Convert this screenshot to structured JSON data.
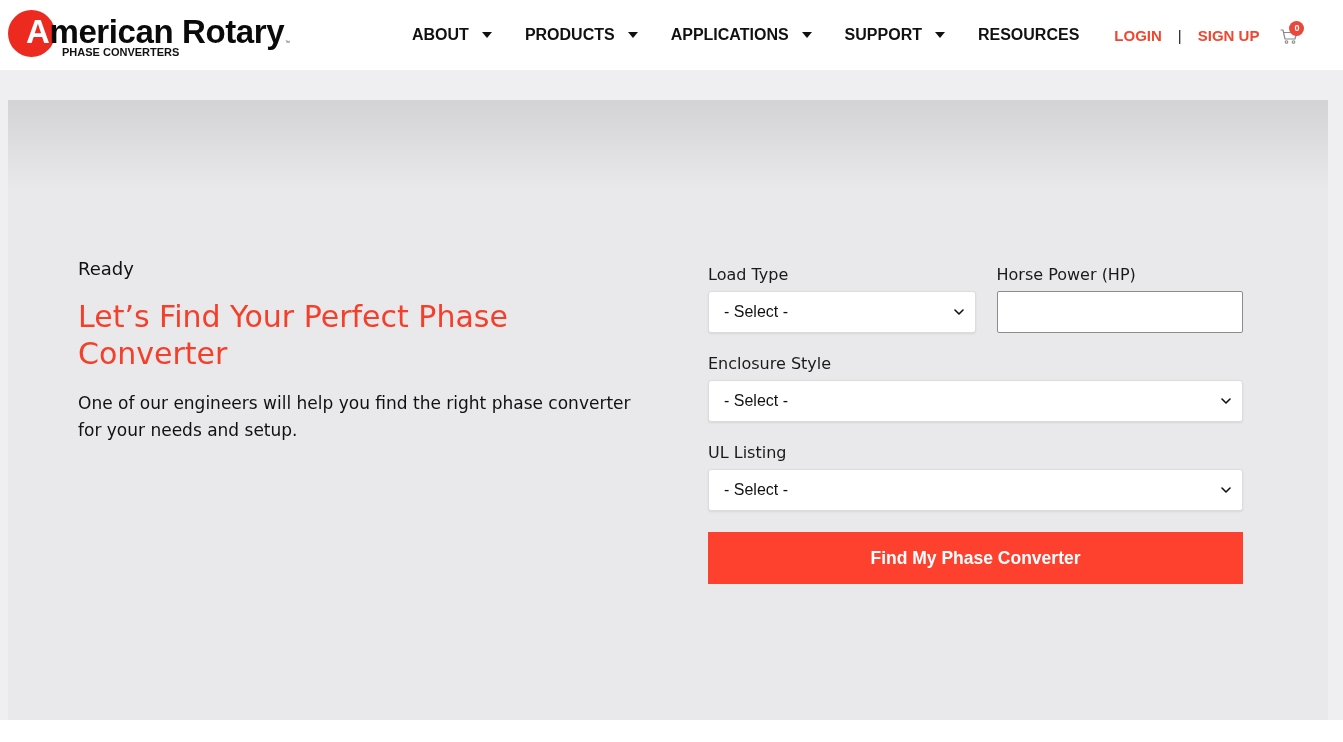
{
  "header": {
    "logo": {
      "name": "American Rotary",
      "trademark": "™",
      "tagline": "PHASE CONVERTERS"
    },
    "nav": [
      {
        "label": "ABOUT",
        "dropdown": true
      },
      {
        "label": "PRODUCTS",
        "dropdown": true
      },
      {
        "label": "APPLICATIONS",
        "dropdown": true
      },
      {
        "label": "SUPPORT",
        "dropdown": true
      },
      {
        "label": "RESOURCES",
        "dropdown": false
      }
    ],
    "account_links": [
      "LOGIN",
      "SIGN UP"
    ],
    "separator": "|",
    "cart": {
      "count": "0"
    }
  },
  "finder": {
    "eyebrow": "Ready",
    "title": "Let’s Find Your Perfect Phase Converter",
    "description": "One of our engineers will help you find the right phase converter for your needs and setup.",
    "field_rows": [
      [
        {
          "kind": "select",
          "label": "Load Type",
          "value": "- Select -"
        },
        {
          "kind": "text",
          "label": "Horse Power (HP)"
        }
      ],
      [
        {
          "kind": "select",
          "label": "Enclosure Style",
          "value": "- Select -"
        }
      ],
      [
        {
          "kind": "select",
          "label": "UL Listing",
          "value": "- Select -"
        }
      ]
    ],
    "submit": "Find My Phase Converter"
  }
}
